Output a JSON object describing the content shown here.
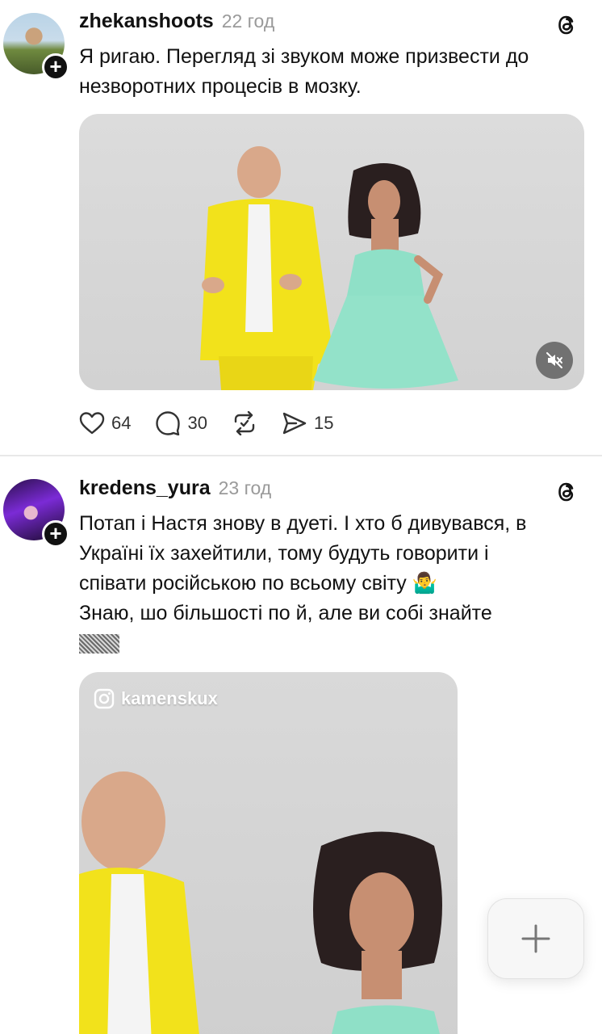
{
  "posts": [
    {
      "username": "zhekanshoots",
      "time": "22 год",
      "text_lines": [
        "Я ригаю. Перегляд зі звуком може призвести до",
        "незворотних процесів в мозку."
      ],
      "media": {
        "type": "video",
        "muted": true,
        "icon": "speaker-muted-icon"
      },
      "stats": {
        "likes": "64",
        "replies": "30",
        "reposts": "",
        "shares": "15"
      }
    },
    {
      "username": "kredens_yura",
      "time": "23 год",
      "text_lines": [
        "Потап і Настя знову в дуеті. І хто б дивувався, в",
        "Україні їх захейтили, тому будуть говорити і",
        "співати російською по всьому світу 🤷‍♂️",
        "Знаю, шо більшості по   й, але ви собі знайте"
      ],
      "media": {
        "type": "video",
        "watermark": "kamenskux",
        "icon": "instagram-icon"
      }
    }
  ],
  "icons": {
    "like": "heart-icon",
    "reply": "comment-icon",
    "repost": "repost-icon",
    "share": "send-icon",
    "threads": "threads-logo-icon",
    "follow": "plus-icon",
    "compose": "plus-icon"
  },
  "colors": {
    "accent": "#111111",
    "muted_text": "#9a9a9a",
    "yellow_suit": "#f2e21b",
    "mint_dress": "#8fe0c7"
  }
}
